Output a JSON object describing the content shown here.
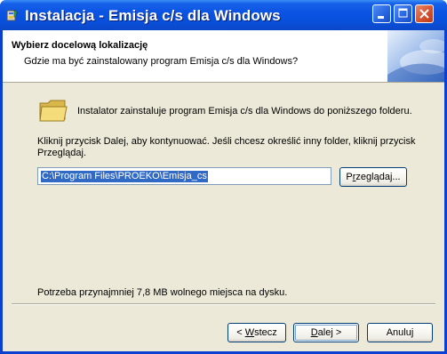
{
  "window": {
    "title": "Instalacja - Emisja c/s dla Windows"
  },
  "header": {
    "title": "Wybierz docelową lokalizację",
    "subtitle": "Gdzie ma być zainstalowany program Emisja c/s dla Windows?"
  },
  "body": {
    "description": "Instalator zainstaluje program Emisja c/s dla Windows do poniższego folderu.",
    "instruction": "Kliknij przycisk Dalej, aby kontynuować. Jeśli chcesz określić inny folder, kliknij przycisk Przeglądaj.",
    "path_value": "C:\\Program Files\\PROEKO\\Emisja_cs",
    "browse_label_pre": "P",
    "browse_label_ul": "r",
    "browse_label_post": "zeglądaj...",
    "space_required": "Potrzeba przynajmniej 7,8 MB wolnego miejsca na dysku."
  },
  "buttons": {
    "back_pre": "< ",
    "back_ul": "W",
    "back_post": "stecz",
    "next_ul": "D",
    "next_post": "alej >",
    "cancel": "Anuluj"
  },
  "icons": {
    "app": "installer-icon",
    "folder": "folder-icon",
    "minimize": "minimize-icon",
    "maximize": "maximize-icon",
    "close": "close-icon"
  },
  "colors": {
    "titlebar": "#0a53e3",
    "selection": "#316ac5",
    "dialog_bg": "#ece9d8"
  }
}
